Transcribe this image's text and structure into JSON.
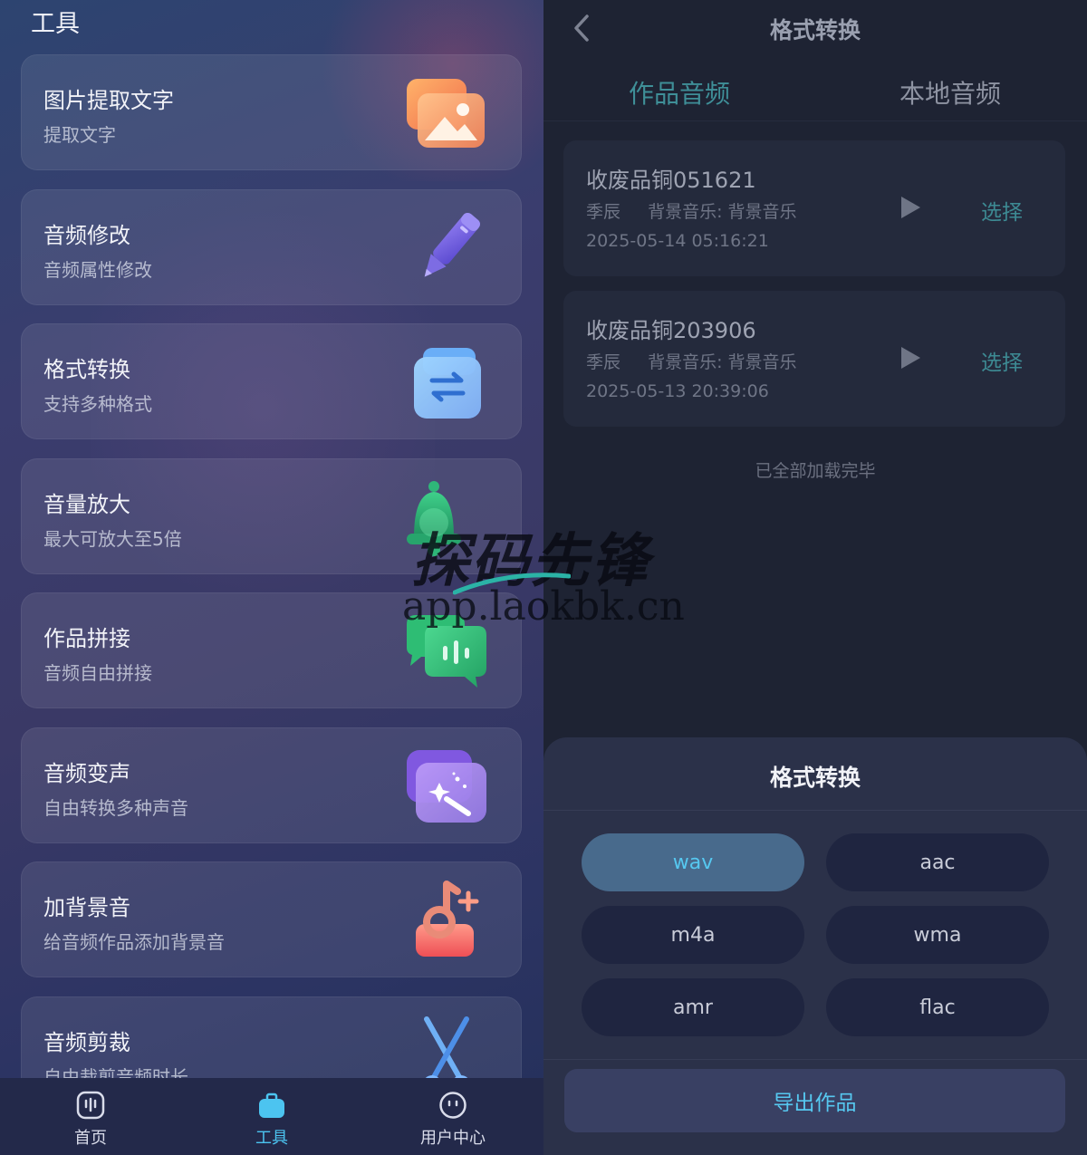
{
  "left": {
    "title": "工具",
    "tools": [
      {
        "name": "图片提取文字",
        "desc": "提取文字",
        "icon": "image-icon"
      },
      {
        "name": "音频修改",
        "desc": "音频属性修改",
        "icon": "pencil-icon"
      },
      {
        "name": "格式转换",
        "desc": "支持多种格式",
        "icon": "convert-icon"
      },
      {
        "name": "音量放大",
        "desc": "最大可放大至5倍",
        "icon": "bell-icon"
      },
      {
        "name": "作品拼接",
        "desc": "音频自由拼接",
        "icon": "chat-icon"
      },
      {
        "name": "音频变声",
        "desc": "自由转换多种声音",
        "icon": "magic-wand-icon"
      },
      {
        "name": "加背景音",
        "desc": "给音频作品添加背景音",
        "icon": "music-note-icon"
      },
      {
        "name": "音频剪裁",
        "desc": "自由裁剪音频时长",
        "icon": "scissors-icon"
      }
    ],
    "nav": [
      {
        "label": "首页",
        "icon": "home-icon",
        "active": false
      },
      {
        "label": "工具",
        "icon": "toolbox-icon",
        "active": true
      },
      {
        "label": "用户中心",
        "icon": "user-icon",
        "active": false
      }
    ]
  },
  "right": {
    "title": "格式转换",
    "tabs": [
      {
        "label": "作品音频",
        "active": true
      },
      {
        "label": "本地音频",
        "active": false
      }
    ],
    "items": [
      {
        "title": "收废品铜051621",
        "author": "季辰",
        "bgm": "背景音乐: 背景音乐",
        "date": "2025-05-14 05:16:21",
        "select": "选择"
      },
      {
        "title": "收废品铜203906",
        "author": "季辰",
        "bgm": "背景音乐: 背景音乐",
        "date": "2025-05-13 20:39:06",
        "select": "选择"
      }
    ],
    "load_done": "已全部加载完毕",
    "sheet": {
      "title": "格式转换",
      "formats": [
        "wav",
        "aac",
        "m4a",
        "wma",
        "amr",
        "flac"
      ],
      "selected": "wav",
      "export_label": "导出作品"
    }
  },
  "watermark": {
    "main": "探码先锋",
    "url": "app.laokbk.cn"
  },
  "colors": {
    "accent": "#56c8f0",
    "teal_text": "#3f8f98",
    "selected_chip": "#486a8c"
  }
}
